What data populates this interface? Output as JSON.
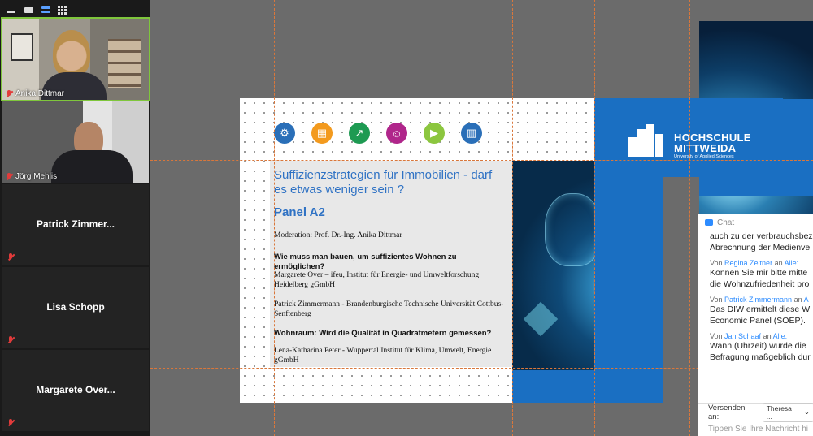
{
  "gallery": {
    "participants": [
      {
        "name": "Anika Dittmar",
        "video": true
      },
      {
        "name": "Jörg Mehlis",
        "video": true
      },
      {
        "name": "Patrick  Zimmer...",
        "video": false
      },
      {
        "name": "Lisa Schopp",
        "video": false
      },
      {
        "name": "Margarete  Over...",
        "video": false
      }
    ],
    "view_buttons": [
      "minimize-icon",
      "single-view-icon",
      "speaker-view-icon",
      "gallery-view-icon"
    ]
  },
  "slide": {
    "title": "Suffizienzstrategien für Immobilien - darf es etwas weniger sein ?",
    "panel": "Panel A2",
    "moderation": "Moderation: Prof. Dr.-Ing. Anika Dittmar",
    "q1": "Wie muss man bauen, um suffizientes Wohnen zu ermöglichen?",
    "speaker1": "Margarete Over – ifeu, Institut für Energie- und Umweltforschung Heidelberg gGmbH",
    "speaker2": "Patrick Zimmermann - Brandenburgische Technische Universität Cottbus-Senftenberg",
    "q2": "Wohnraum: Wird die Qualität in Quadratmetern gemessen?",
    "speaker3": "Lena-Katharina Peter - Wuppertal Institut für Klima, Umwelt, Energie gGmbH",
    "icon_colors": [
      "#2a6fb8",
      "#f39a1e",
      "#1e9a52",
      "#b0268b",
      "#8cc63f",
      "#2a6fb8"
    ],
    "icons": [
      "gear-icon",
      "chip-icon",
      "chart-growth-icon",
      "people-icon",
      "video-screen-icon",
      "building-icon"
    ]
  },
  "logo": {
    "line1": "HOCHSCHULE",
    "line2": "MITTWEIDA",
    "sub": "University of Applied Sciences"
  },
  "chat": {
    "header": "Chat",
    "messages": [
      {
        "from": "",
        "to": "",
        "lines": [
          "auch zu der verbrauchsbez",
          "Abrechnung der Medienve"
        ]
      },
      {
        "from": "Regina Zeitner",
        "to": "Alle:",
        "lines": [
          "Können Sie mir bitte mitte",
          "die Wohnzufriedenheit pro"
        ]
      },
      {
        "from": "Patrick Zimmermann",
        "to": "A",
        "lines": [
          "Das DIW ermittelt diese W",
          "Economic Panel (SOEP)."
        ]
      },
      {
        "from": "Jan Schaaf",
        "to": "Alle:",
        "lines": [
          "Wann (Uhrzeit) wurde die",
          "Befragung maßgeblich dur"
        ]
      }
    ],
    "send_label": "Versenden an:",
    "send_target": "Theresa ...",
    "input_placeholder": "Tippen Sie Ihre Nachricht hi",
    "an_label": "an"
  }
}
